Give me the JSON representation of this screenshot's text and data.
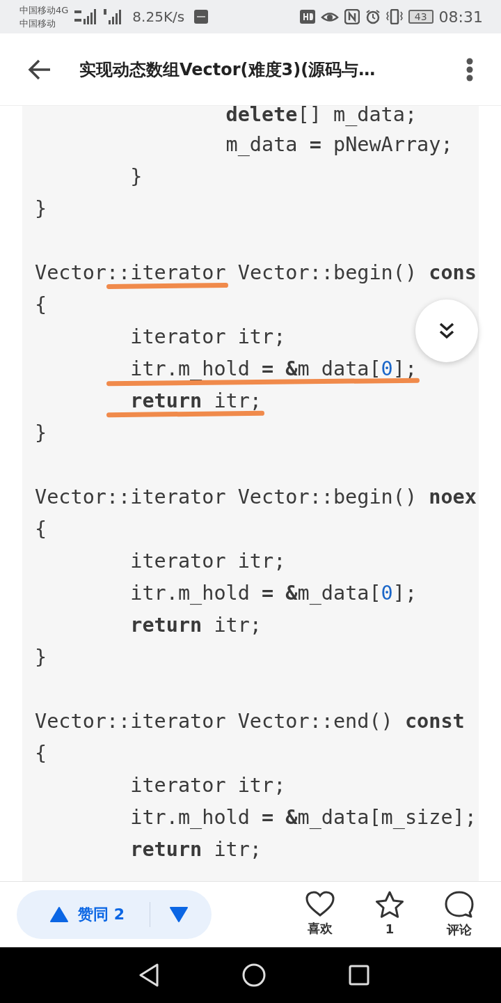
{
  "status_bar": {
    "carriers": [
      "中国移动4G",
      "中国移动"
    ],
    "net_speed": "8.25K/s",
    "battery": "43",
    "time": "08:31"
  },
  "header": {
    "title": "实现动态数组Vector(难度3)(源码与…"
  },
  "code_lines": [
    {
      "kind": "code",
      "tokens": [
        {
          "text": "                delete",
          "kind": "keyword"
        },
        {
          "text": "[] m_data;",
          "kind": "plain"
        }
      ]
    },
    {
      "kind": "code",
      "tokens": [
        {
          "text": "                m_data ",
          "kind": "plain"
        },
        {
          "text": "=",
          "kind": "keyword"
        },
        {
          "text": " pNewArray;",
          "kind": "plain"
        }
      ]
    },
    {
      "kind": "code",
      "tokens": [
        {
          "text": "        }",
          "kind": "plain"
        }
      ]
    },
    {
      "kind": "code",
      "tokens": [
        {
          "text": "}",
          "kind": "plain"
        }
      ]
    },
    {
      "kind": "blank"
    },
    {
      "kind": "code",
      "tokens": [
        {
          "text": "Vector::",
          "kind": "plain"
        },
        {
          "text": "iterator",
          "kind": "plain",
          "underlined": true
        },
        {
          "text": " Vector::begin() ",
          "kind": "plain"
        },
        {
          "text": "cons",
          "kind": "keyword"
        }
      ]
    },
    {
      "kind": "code",
      "tokens": [
        {
          "text": "{",
          "kind": "plain"
        }
      ]
    },
    {
      "kind": "code",
      "tokens": [
        {
          "text": "        iterator itr;",
          "kind": "plain"
        }
      ]
    },
    {
      "kind": "code",
      "tokens": [
        {
          "text": "        itr.m_hold ",
          "kind": "plain",
          "underlined": true
        },
        {
          "text": "= &",
          "kind": "keyword",
          "underlined": true
        },
        {
          "text": "m_data[",
          "kind": "plain",
          "underlined": true
        },
        {
          "text": "0",
          "kind": "number",
          "underlined": true
        },
        {
          "text": "];",
          "kind": "plain",
          "underlined": true
        }
      ]
    },
    {
      "kind": "code",
      "tokens": [
        {
          "text": "        return",
          "kind": "keyword",
          "underlined": true
        },
        {
          "text": " itr;",
          "kind": "plain",
          "underlined": true
        }
      ]
    },
    {
      "kind": "code",
      "tokens": [
        {
          "text": "}",
          "kind": "plain"
        }
      ]
    },
    {
      "kind": "blank"
    },
    {
      "kind": "code",
      "tokens": [
        {
          "text": "Vector::iterator Vector::begin() ",
          "kind": "plain"
        },
        {
          "text": "noex",
          "kind": "keyword"
        }
      ]
    },
    {
      "kind": "code",
      "tokens": [
        {
          "text": "{",
          "kind": "plain"
        }
      ]
    },
    {
      "kind": "code",
      "tokens": [
        {
          "text": "        iterator itr;",
          "kind": "plain"
        }
      ]
    },
    {
      "kind": "code",
      "tokens": [
        {
          "text": "        itr.m_hold ",
          "kind": "plain"
        },
        {
          "text": "= &",
          "kind": "keyword"
        },
        {
          "text": "m_data[",
          "kind": "plain"
        },
        {
          "text": "0",
          "kind": "number"
        },
        {
          "text": "];",
          "kind": "plain"
        }
      ]
    },
    {
      "kind": "code",
      "tokens": [
        {
          "text": "        return",
          "kind": "keyword"
        },
        {
          "text": " itr;",
          "kind": "plain"
        }
      ]
    },
    {
      "kind": "code",
      "tokens": [
        {
          "text": "}",
          "kind": "plain"
        }
      ]
    },
    {
      "kind": "blank"
    },
    {
      "kind": "code",
      "tokens": [
        {
          "text": "Vector::iterator Vector::end() ",
          "kind": "plain"
        },
        {
          "text": "const",
          "kind": "keyword"
        }
      ]
    },
    {
      "kind": "code",
      "tokens": [
        {
          "text": "{",
          "kind": "plain"
        }
      ]
    },
    {
      "kind": "code",
      "tokens": [
        {
          "text": "        iterator itr;",
          "kind": "plain"
        }
      ]
    },
    {
      "kind": "code",
      "tokens": [
        {
          "text": "        itr.m_hold ",
          "kind": "plain"
        },
        {
          "text": "= &",
          "kind": "keyword"
        },
        {
          "text": "m_data[m_size];",
          "kind": "plain"
        }
      ]
    },
    {
      "kind": "code",
      "tokens": [
        {
          "text": "        return",
          "kind": "keyword"
        },
        {
          "text": " itr;",
          "kind": "plain"
        }
      ]
    }
  ],
  "vote": {
    "up_label": "赞同 2"
  },
  "actions": [
    {
      "kind": "like",
      "label": "喜欢"
    },
    {
      "kind": "favorite",
      "label": "1"
    },
    {
      "kind": "comment",
      "label": "评论"
    }
  ]
}
